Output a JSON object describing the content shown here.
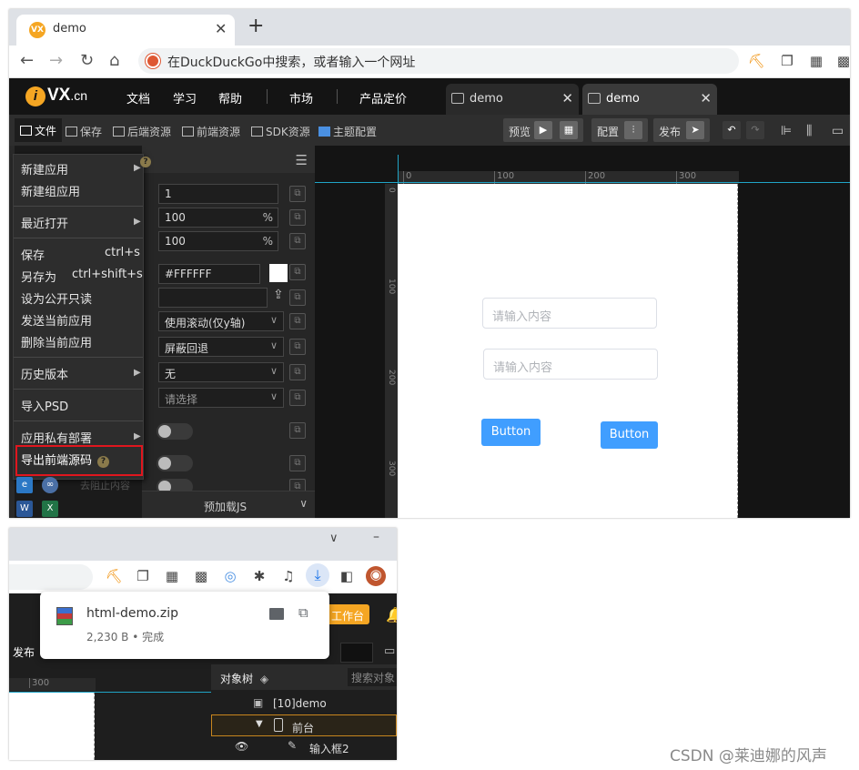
{
  "browser": {
    "tab_title": "demo",
    "tab_favicon_text": "VX",
    "new_tab": "+",
    "close": "✕",
    "address_placeholder": "在DuckDuckGo中搜索，或者输入一个网址"
  },
  "app": {
    "logo_text": "VX",
    "logo_suffix": ".cn",
    "nav": [
      "文档",
      "学习",
      "帮助",
      "市场",
      "产品定价"
    ],
    "tabs": [
      {
        "label": "demo",
        "active": false
      },
      {
        "label": "demo",
        "active": true
      }
    ]
  },
  "toolbar": {
    "file": "文件",
    "save": "保存",
    "backend": "后端资源",
    "frontend": "前端资源",
    "sdk": "SDK资源",
    "theme": "主题配置",
    "preview": "预览",
    "config": "配置",
    "publish": "发布"
  },
  "file_menu": {
    "items": [
      {
        "label": "新建应用",
        "submenu": true
      },
      {
        "label": "新建组应用"
      },
      {
        "label": "最近打开",
        "submenu": true
      },
      {
        "label": "保存",
        "shortcut": "ctrl+s"
      },
      {
        "label": "另存为",
        "shortcut": "ctrl+shift+s"
      },
      {
        "label": "设为公开只读"
      },
      {
        "label": "发送当前应用"
      },
      {
        "label": "删除当前应用"
      },
      {
        "label": "历史版本",
        "submenu": true
      },
      {
        "label": "导入PSD"
      },
      {
        "label": "应用私有部署",
        "submenu": true
      },
      {
        "label": "导出前端源码",
        "highlighted": true
      }
    ],
    "help_mark": "?"
  },
  "props": {
    "values": [
      "1",
      "100",
      "100",
      "#FFFFFF"
    ],
    "percent": "%",
    "selects": [
      "使用滚动(仅y轴)",
      "屏蔽回退",
      "无",
      "请选择"
    ],
    "faded_label": "去阻止内容",
    "preload": "预加载JS",
    "swatch_color": "#FFFFFF"
  },
  "canvas": {
    "ruler_top": [
      "0",
      "100",
      "200",
      "300"
    ],
    "ruler_left": [
      "0",
      "100",
      "200",
      "300"
    ],
    "input_placeholder": "请输入内容",
    "button_label": "Button",
    "accent": "#409EFF",
    "guide_color": "#20A4C6"
  },
  "download": {
    "filename": "html-demo.zip",
    "meta": "2,230 B • 完成",
    "workbench": "工作台",
    "publish": "发布",
    "ruler_label": "300",
    "object_tree": "对象树",
    "search_objects": "搜索对象",
    "tree": [
      {
        "label": "[10]demo"
      },
      {
        "label": "前台",
        "expanded": true,
        "selected": true
      },
      {
        "label": "输入框2"
      }
    ]
  },
  "watermark": "CSDN @莱迪娜的风声"
}
